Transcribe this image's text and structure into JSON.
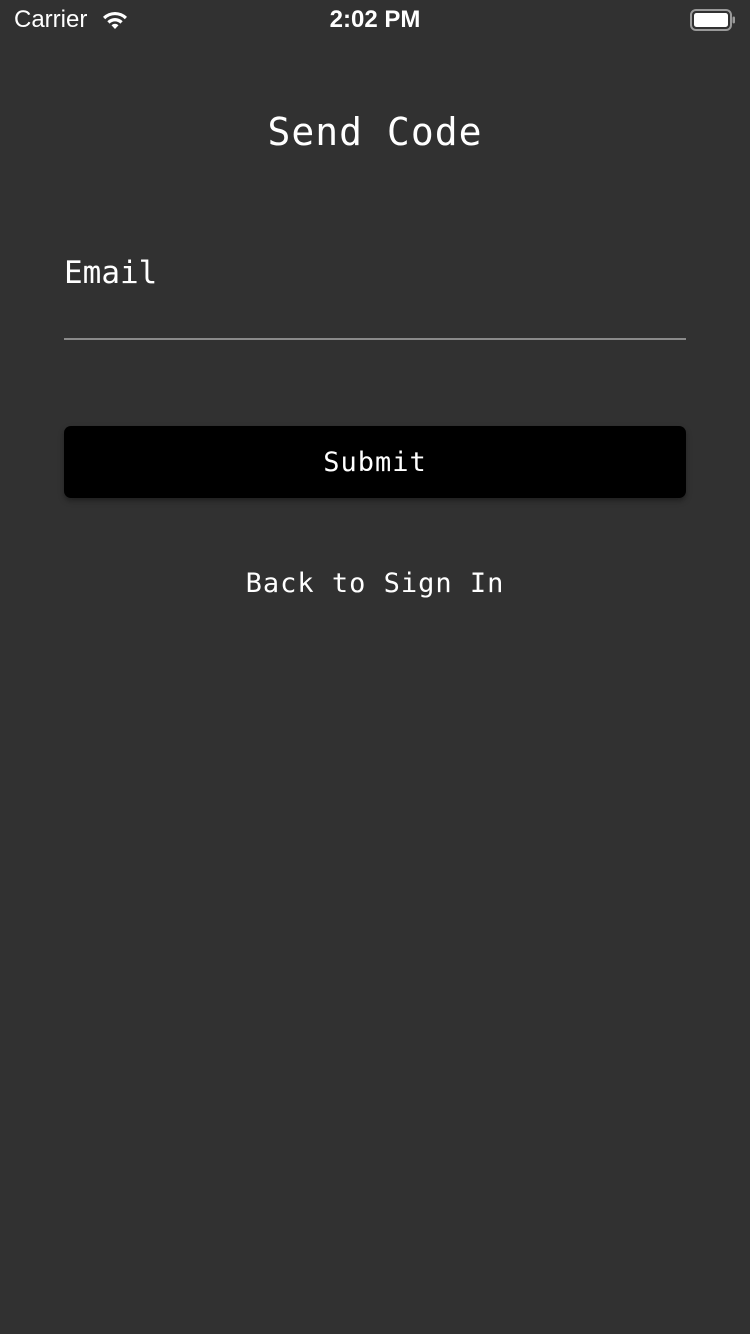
{
  "status_bar": {
    "carrier": "Carrier",
    "time": "2:02 PM",
    "wifi_icon": "wifi-icon",
    "battery_icon": "battery-full-icon"
  },
  "page": {
    "title": "Send Code"
  },
  "form": {
    "email_placeholder": "Email",
    "email_value": "",
    "submit_label": "Submit",
    "back_label": "Back to Sign In"
  },
  "colors": {
    "background": "#313131",
    "button": "#000000",
    "text": "#ffffff",
    "input_underline": "#8a8a8a"
  }
}
